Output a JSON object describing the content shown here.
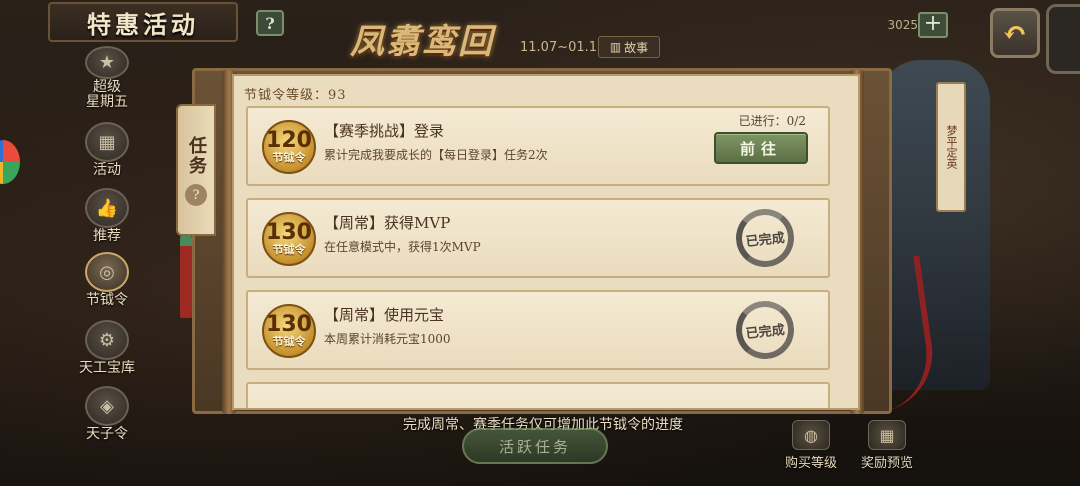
{
  "header": {
    "title": "特惠活动",
    "help_label": "?",
    "event_logo": "凤翥鸾回",
    "event_date": "11.07~01.15",
    "story_label": "故事",
    "currency_value": "3025",
    "plus_label": "+",
    "back_icon": "back-arrow-icon"
  },
  "sidebar": {
    "items": [
      {
        "label": "超级\n星期五",
        "icon": "star-icon",
        "glyph": "★"
      },
      {
        "label": "活动",
        "icon": "gift-icon",
        "glyph": "▦"
      },
      {
        "label": "推荐",
        "icon": "thumbs-up-icon",
        "glyph": "👍"
      },
      {
        "label": "节钺令",
        "icon": "token-icon",
        "glyph": "◎"
      },
      {
        "label": "天工宝库",
        "icon": "treasure-icon",
        "glyph": "⚙"
      },
      {
        "label": "天子令",
        "icon": "decree-icon",
        "glyph": "◈"
      }
    ]
  },
  "task_tab": {
    "label": "任务",
    "help_label": "?"
  },
  "panel": {
    "level_text": "节钺令等级：93",
    "unit_label": "节钺令",
    "tasks": [
      {
        "points": "120",
        "title": "【赛季挑战】登录",
        "desc": "累计完成我要成长的【每日登录】任务2次",
        "progress": "已进行：0/2",
        "action": "前往",
        "status": "go"
      },
      {
        "points": "130",
        "title": "【周常】获得MVP",
        "desc": "在任意模式中，获得1次MVP",
        "status": "done",
        "done_label": "已完成"
      },
      {
        "points": "130",
        "title": "【周常】使用元宝",
        "desc": "本周累计消耗元宝1000",
        "status": "done",
        "done_label": "已完成"
      }
    ]
  },
  "right_tag": {
    "text": "梦平定英"
  },
  "footer": {
    "note": "完成周常、赛季任务仅可增加此节钺令的进度",
    "active_tasks_label": "活跃任务",
    "buy_level_label": "购买等级",
    "reward_preview_label": "奖励预览"
  }
}
